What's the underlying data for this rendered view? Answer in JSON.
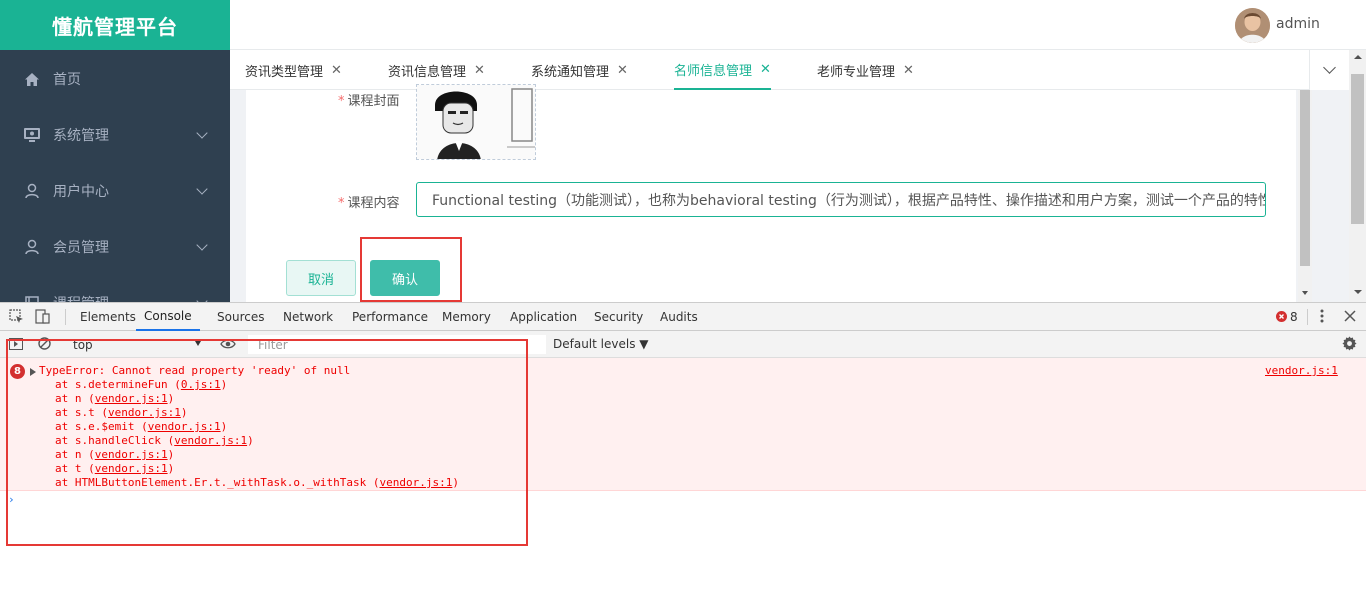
{
  "app": {
    "logo": "懂航管理平台",
    "user": "admin",
    "menu": [
      {
        "label": "首页",
        "icon": "home-icon"
      },
      {
        "label": "系统管理",
        "icon": "monitor-icon"
      },
      {
        "label": "用户中心",
        "icon": "user-icon"
      },
      {
        "label": "会员管理",
        "icon": "user-icon"
      },
      {
        "label": "课程管理",
        "icon": "book-icon"
      }
    ],
    "tabs": [
      {
        "label": "资讯类型管理"
      },
      {
        "label": "资讯信息管理"
      },
      {
        "label": "系统通知管理"
      },
      {
        "label": "名师信息管理",
        "active": true
      },
      {
        "label": "老师专业管理"
      }
    ],
    "tab_close": "✕",
    "form": {
      "cover_label": "课程封面",
      "content_label": "课程内容",
      "required_mark": "*",
      "content_value": "Functional testing（功能测试），也称为behavioral testing（行为测试），根据产品特性、操作描述和用户方案，测试一个产品的特性和可操作行为以确定它们满足设计需求",
      "cancel": "取消",
      "confirm": "确认"
    }
  },
  "devtools": {
    "tabs": [
      "Elements",
      "Console",
      "Sources",
      "Network",
      "Performance",
      "Memory",
      "Application",
      "Security",
      "Audits"
    ],
    "active_tab": "Console",
    "error_badge": "8",
    "context": "top",
    "filter_placeholder": "Filter",
    "levels": "Default levels ▼",
    "error": {
      "count": "8",
      "message": "TypeError: Cannot read property 'ready' of null",
      "source": "vendor.js:1",
      "stack": [
        {
          "text": "at s.determineFun (",
          "link": "0.js:1"
        },
        {
          "text": "at n (",
          "link": "vendor.js:1"
        },
        {
          "text": "at s.t (",
          "link": "vendor.js:1"
        },
        {
          "text": "at s.e.$emit (",
          "link": "vendor.js:1"
        },
        {
          "text": "at s.handleClick (",
          "link": "vendor.js:1"
        },
        {
          "text": "at n (",
          "link": "vendor.js:1"
        },
        {
          "text": "at t (",
          "link": "vendor.js:1"
        },
        {
          "text": "at HTMLButtonElement.Er.t._withTask.o._withTask (",
          "link": "vendor.js:1"
        }
      ]
    },
    "prompt": "›"
  },
  "colors": {
    "brand": "#1ab394",
    "sidebar": "#2f4050",
    "error": "#e00",
    "highlight": "#e53935"
  }
}
